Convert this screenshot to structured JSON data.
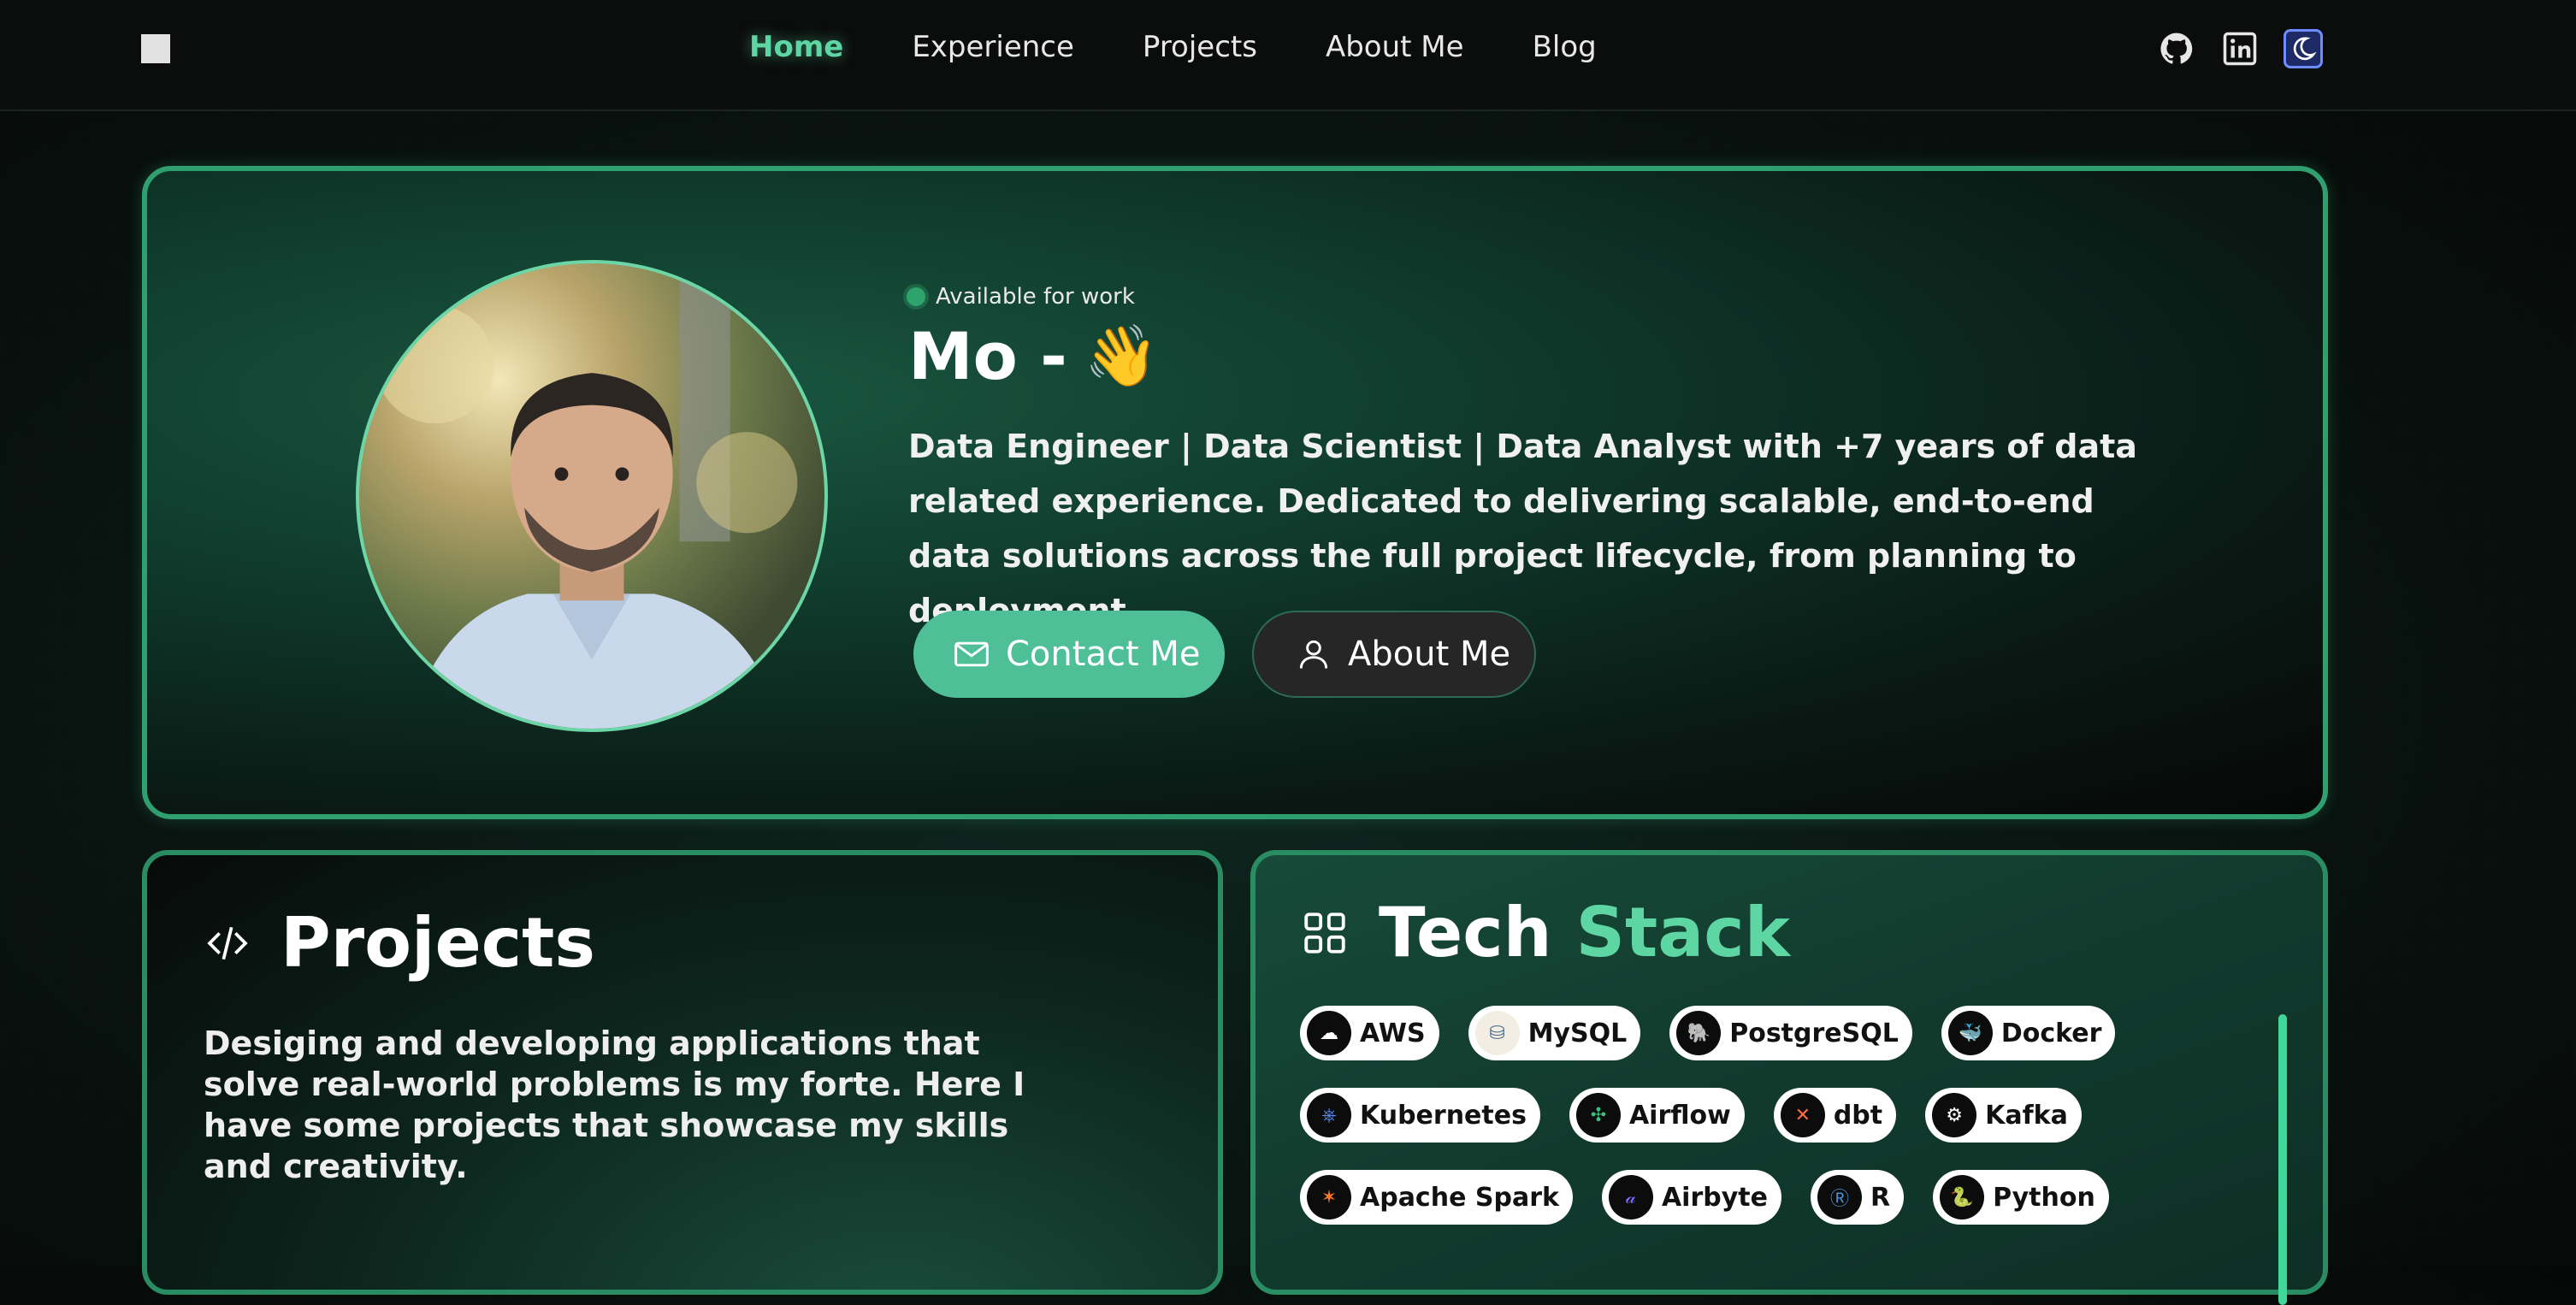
{
  "nav": {
    "links": [
      {
        "label": "Home",
        "active": true
      },
      {
        "label": "Experience"
      },
      {
        "label": "Projects"
      },
      {
        "label": "About Me"
      },
      {
        "label": "Blog"
      }
    ],
    "icons": [
      "github-icon",
      "linkedin-icon",
      "theme-toggle-icon"
    ]
  },
  "hero": {
    "status": "Available for work",
    "title": "Mo -",
    "emoji": "👋",
    "description": "Data Engineer | Data Scientist | Data Analyst with +7 years of data related experience. Dedicated to delivering scalable, end-to-end data solutions across the full project lifecycle, from planning to deployment.",
    "contact_label": "Contact Me",
    "about_label": "About Me"
  },
  "projects": {
    "title": "Projects",
    "description": "Desiging and developing applications that solve real-world problems is my forte. Here I have some projects that showcase my skills and creativity."
  },
  "tech": {
    "title_main": "Tech",
    "title_accent": "Stack",
    "rows": [
      [
        "AWS",
        "MySQL",
        "PostgreSQL",
        "Docker"
      ],
      [
        "Kubernetes",
        "Airflow",
        "dbt",
        "Kafka"
      ],
      [
        "Apache Spark",
        "Airbyte",
        "R",
        "Python"
      ]
    ]
  },
  "colors": {
    "accent": "#5ed6a4",
    "card_border": "#2f9f70",
    "button_primary": "#4fbf98",
    "background": "#0a1612"
  }
}
